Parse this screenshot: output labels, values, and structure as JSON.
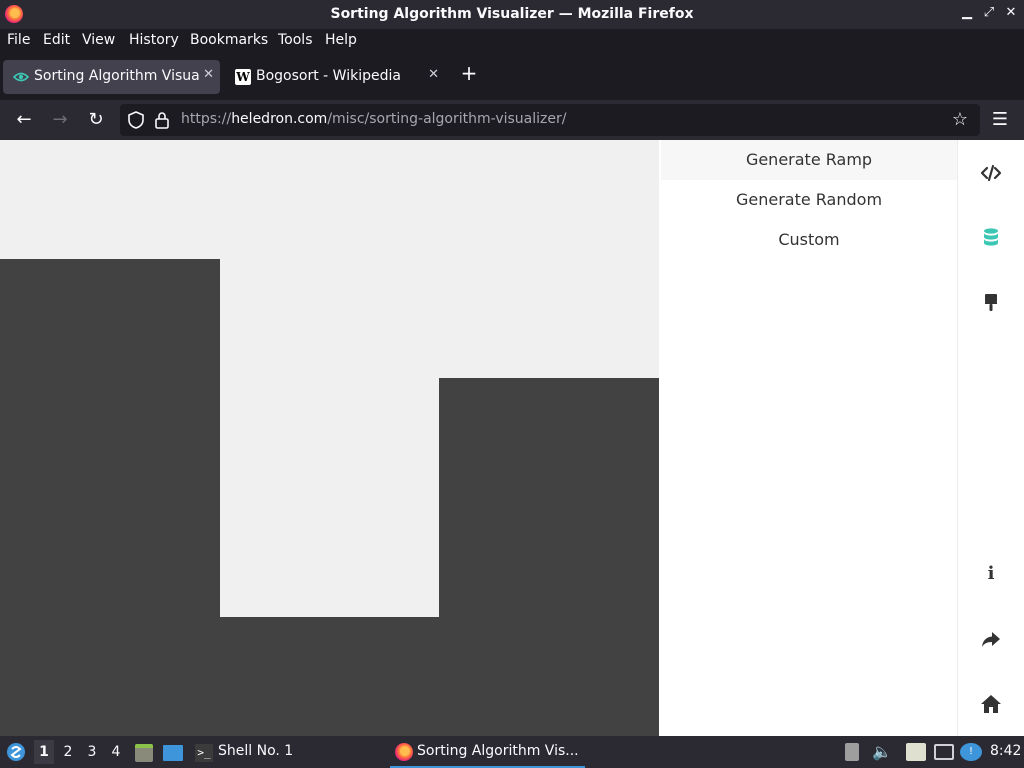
{
  "window": {
    "title": "Sorting Algorithm Visualizer — Mozilla Firefox",
    "controls": [
      "▁",
      "⤢",
      "✕"
    ]
  },
  "menu": [
    "File",
    "Edit",
    "View",
    "History",
    "Bookmarks",
    "Tools",
    "Help"
  ],
  "tabs": [
    {
      "label": "Sorting Algorithm Visualizer",
      "icon": "visualizer-favicon",
      "active": true
    },
    {
      "label": "Bogosort - Wikipedia",
      "icon": "wikipedia-favicon",
      "active": false
    }
  ],
  "nav": {
    "url_prefix": "https://",
    "url_host": "heledron.com",
    "url_path": "/misc/sorting-algorithm-visualizer/"
  },
  "panel": {
    "options": [
      "Generate Ramp",
      "Generate Random",
      "Custom"
    ]
  },
  "visualization": {
    "bar_color": "#424242",
    "background": "#f0f0f0",
    "bars": [
      0.8,
      0.2,
      0.6
    ]
  },
  "rail_icons": {
    "top": [
      "code-icon",
      "database-icon",
      "paintbrush-icon"
    ],
    "bottom": [
      "info-icon",
      "share-icon",
      "home-icon"
    ],
    "accent": "#3cc7b4"
  },
  "taskbar": {
    "workspaces": [
      "1",
      "2",
      "3",
      "4"
    ],
    "shell_label": "Shell No. 1",
    "firefox_label": "Sorting Algorithm Vis...",
    "clock": "8:42"
  }
}
